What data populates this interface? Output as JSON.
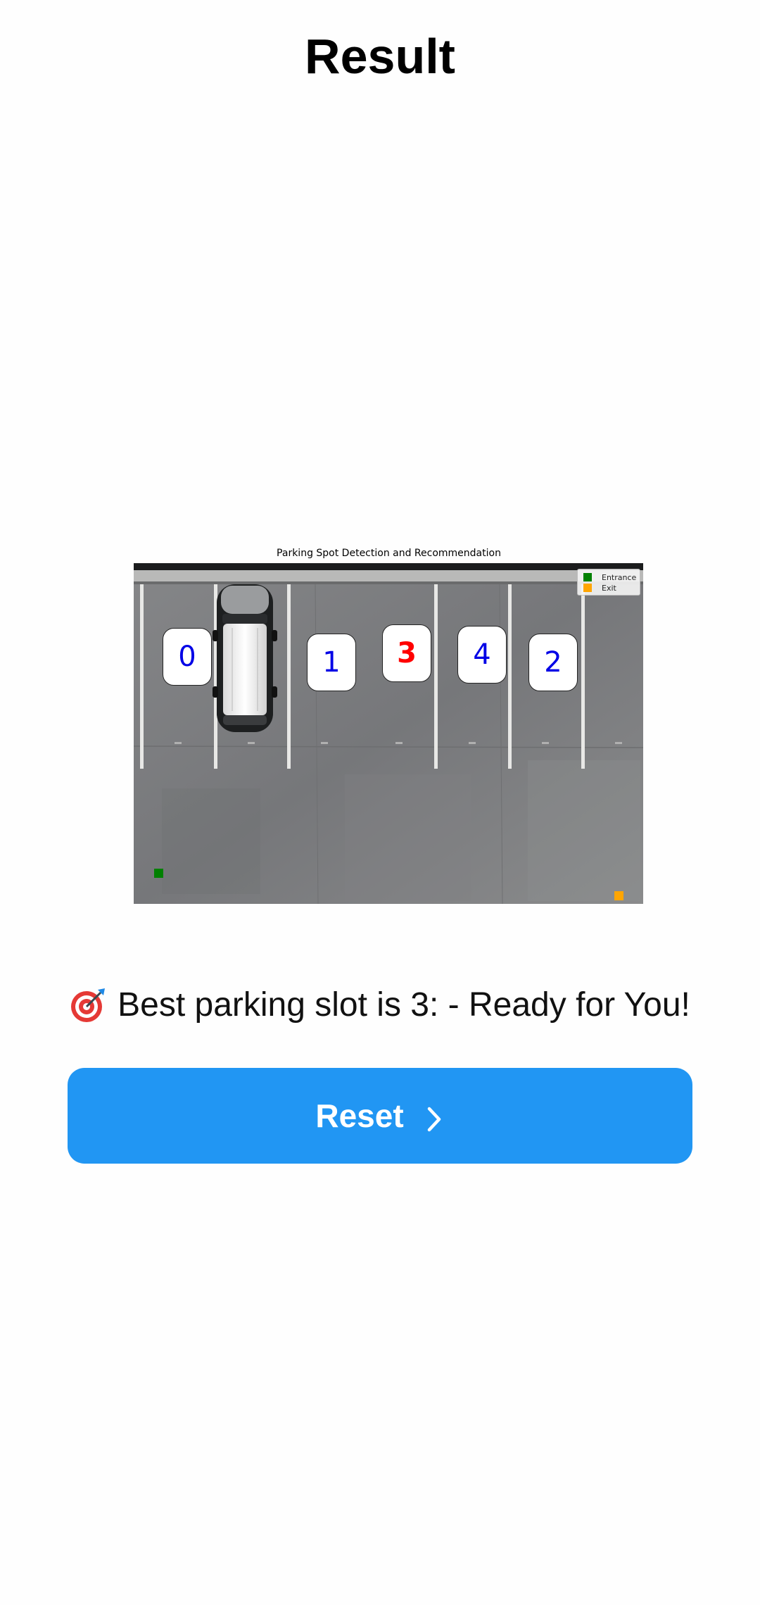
{
  "header": {
    "title": "Result"
  },
  "figure": {
    "title": "Parking Spot Detection and Recommendation",
    "legend": [
      {
        "label": "Entrance",
        "color": "#008000"
      },
      {
        "label": "Exit",
        "color": "#ffa500"
      }
    ],
    "slots": [
      {
        "label": "0",
        "best": false
      },
      {
        "label": "1",
        "best": false
      },
      {
        "label": "3",
        "best": true
      },
      {
        "label": "4",
        "best": false
      },
      {
        "label": "2",
        "best": false
      }
    ],
    "slot_color": "#0000e6",
    "best_slot_color": "#ff0000",
    "entrance_color": "#008000",
    "exit_color": "#ffa500"
  },
  "result": {
    "icon": "target-icon",
    "message": "Best parking slot is 3: - Ready for You!"
  },
  "actions": {
    "reset_label": "Reset",
    "reset_icon": "chevron-right-icon",
    "accent_color": "#2196f3"
  }
}
